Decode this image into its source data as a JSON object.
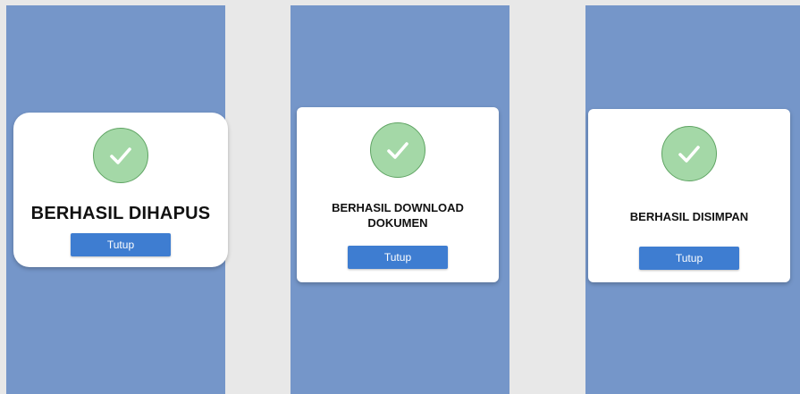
{
  "colors": {
    "page_background": "#e8e8e8",
    "panel_background": "#7596c9",
    "dialog_background": "#ffffff",
    "success_circle_fill": "#a4d8a7",
    "success_circle_border": "#5fa463",
    "button_background": "#3e7dd1",
    "button_text": "#ffffff"
  },
  "dialogs": [
    {
      "icon": "check-circle-icon",
      "title": "BERHASIL DIHAPUS",
      "button_label": "Tutup"
    },
    {
      "icon": "check-circle-icon",
      "title": "BERHASIL DOWNLOAD DOKUMEN",
      "button_label": "Tutup"
    },
    {
      "icon": "check-circle-icon",
      "title": "BERHASIL DISIMPAN",
      "button_label": "Tutup"
    }
  ]
}
